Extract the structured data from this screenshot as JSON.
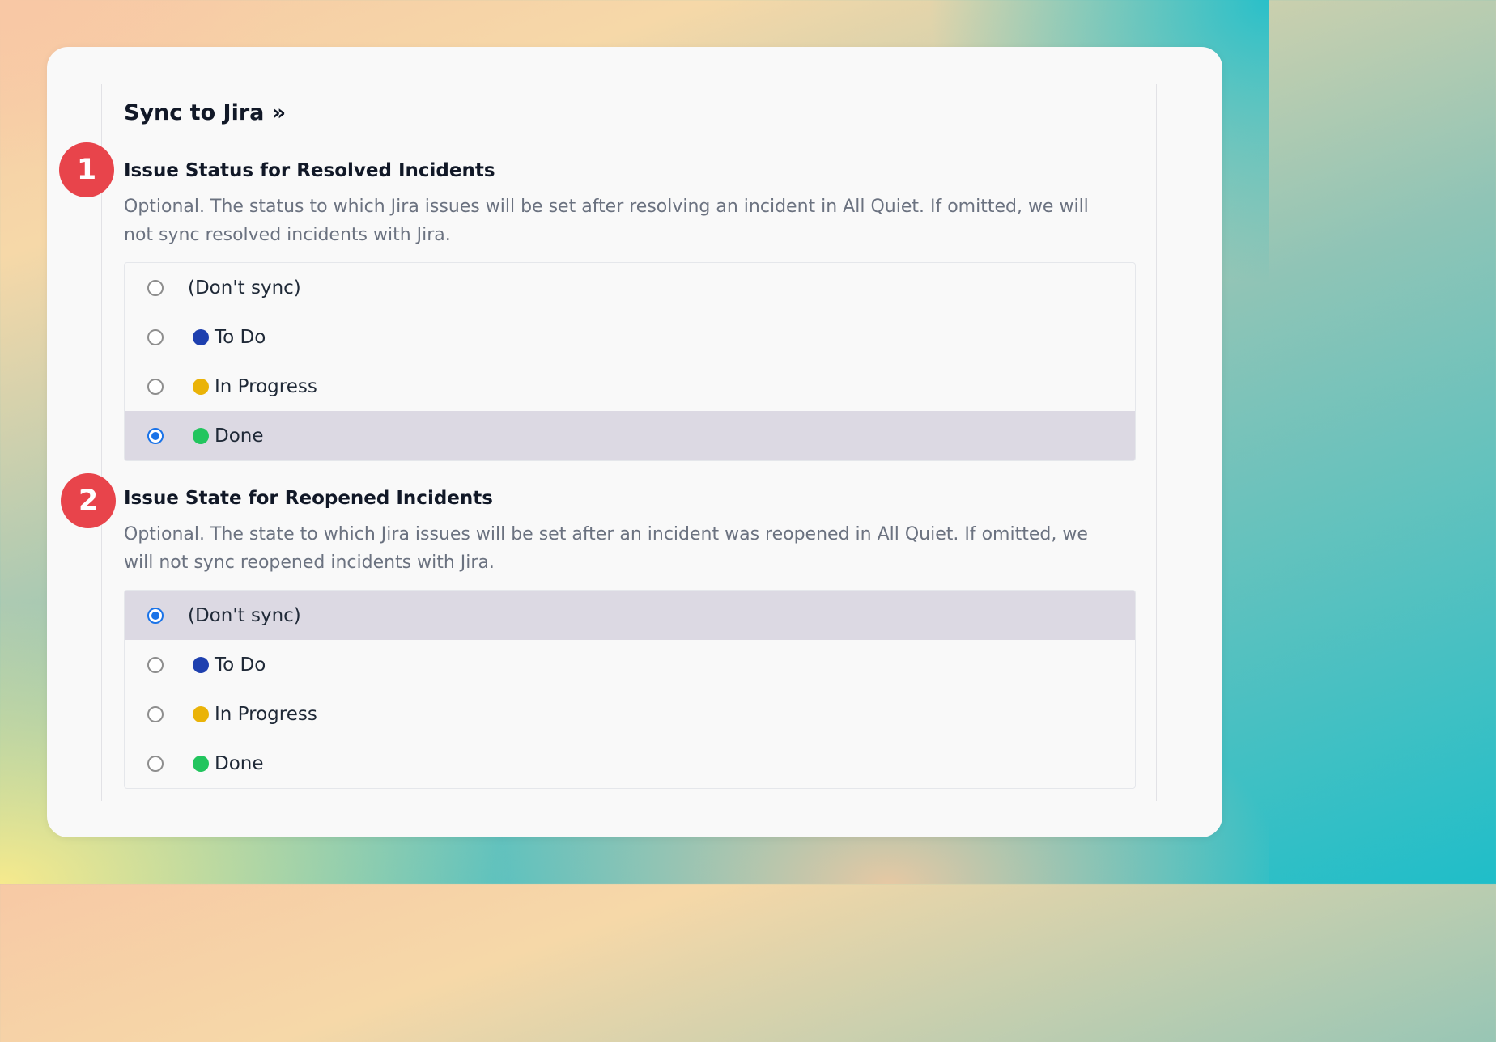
{
  "page": {
    "title": "Sync to Jira »"
  },
  "colors": {
    "step_badge": "#e8444b",
    "selected_row": "#dcd9e3",
    "radio_selected": "#1a73e8",
    "status_todo": "#1e40af",
    "status_in_progress": "#eab308",
    "status_done": "#22c55e"
  },
  "steps": [
    {
      "label": "1"
    },
    {
      "label": "2"
    }
  ],
  "sections": [
    {
      "heading": "Issue Status for Resolved Incidents",
      "description": "Optional. The status to which Jira issues will be set after resolving an incident in All Quiet. If omitted, we will not sync resolved incidents with Jira.",
      "selected": "Done",
      "options": [
        {
          "label": "(Don't sync)",
          "dot": null
        },
        {
          "label": "To Do",
          "dot": "#1e40af"
        },
        {
          "label": "In Progress",
          "dot": "#eab308"
        },
        {
          "label": "Done",
          "dot": "#22c55e"
        }
      ]
    },
    {
      "heading": "Issue State for Reopened Incidents",
      "description": "Optional. The state to which Jira issues will be set after an incident was reopened in All Quiet. If omitted, we will not sync reopened incidents with Jira.",
      "selected": "(Don't sync)",
      "options": [
        {
          "label": "(Don't sync)",
          "dot": null
        },
        {
          "label": "To Do",
          "dot": "#1e40af"
        },
        {
          "label": "In Progress",
          "dot": "#eab308"
        },
        {
          "label": "Done",
          "dot": "#22c55e"
        }
      ]
    }
  ]
}
